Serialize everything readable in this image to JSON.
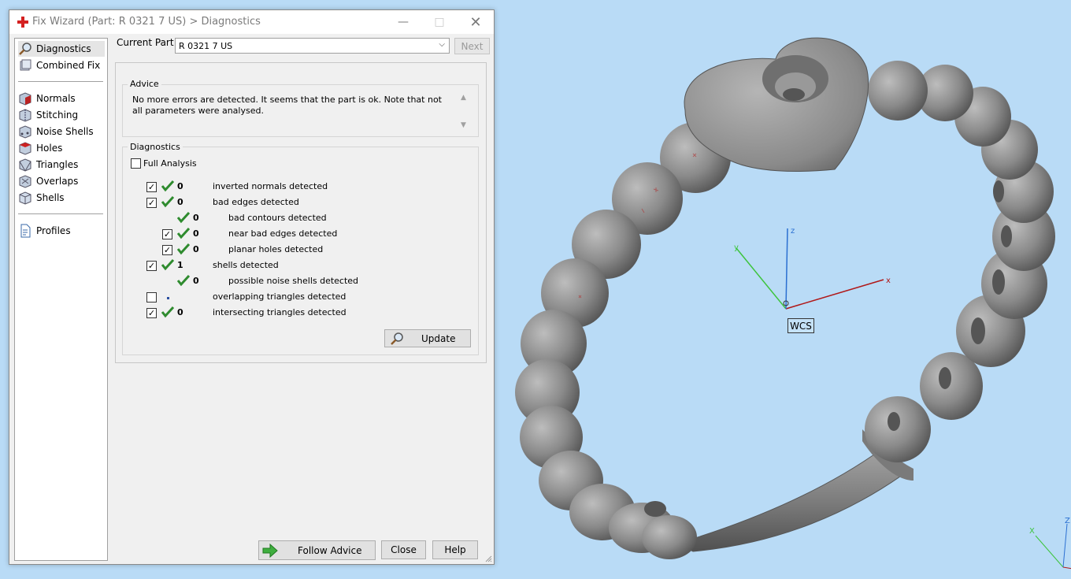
{
  "window": {
    "title": "Fix Wizard (Part: R 0321 7 US) > Diagnostics",
    "minimize_glyph": "—",
    "maximize_glyph": "□",
    "close_glyph": "✕"
  },
  "nav": {
    "items": [
      {
        "label": "Diagnostics",
        "icon": "magnifier-icon",
        "selected": true
      },
      {
        "label": "Combined Fix",
        "icon": "combined-fix-icon"
      },
      {
        "label": "Normals",
        "icon": "normals-cube-icon"
      },
      {
        "label": "Stitching",
        "icon": "stitching-cube-icon"
      },
      {
        "label": "Noise Shells",
        "icon": "noise-shells-cube-icon"
      },
      {
        "label": "Holes",
        "icon": "holes-cube-icon"
      },
      {
        "label": "Triangles",
        "icon": "triangles-cube-icon"
      },
      {
        "label": "Overlaps",
        "icon": "overlaps-cube-icon"
      },
      {
        "label": "Shells",
        "icon": "shells-cube-icon"
      },
      {
        "label": "Profiles",
        "icon": "document-icon"
      }
    ]
  },
  "current_part": {
    "label": "Current Part:",
    "value": "R 0321 7 US",
    "next_label": "Next"
  },
  "advice": {
    "title": "Advice",
    "text": "No more errors are detected. It seems that the part is ok. Note that not all parameters were analysed."
  },
  "diagnostics": {
    "title": "Diagnostics",
    "full_analysis_label": "Full Analysis",
    "full_analysis_checked": false,
    "rows": [
      {
        "checkbox": true,
        "checked": true,
        "status": "ok",
        "count": "0",
        "label": "inverted normals detected",
        "indent": 0
      },
      {
        "checkbox": true,
        "checked": true,
        "status": "ok",
        "count": "0",
        "label": "bad edges detected",
        "indent": 0
      },
      {
        "checkbox": false,
        "checked": false,
        "status": "ok",
        "count": "0",
        "label": "bad contours detected",
        "indent": 1
      },
      {
        "checkbox": true,
        "checked": true,
        "status": "ok",
        "count": "0",
        "label": "near bad edges detected",
        "indent": 1
      },
      {
        "checkbox": true,
        "checked": true,
        "status": "ok",
        "count": "0",
        "label": "planar holes detected",
        "indent": 1
      },
      {
        "checkbox": true,
        "checked": true,
        "status": "ok",
        "count": "1",
        "label": "shells detected",
        "indent": 0
      },
      {
        "checkbox": false,
        "checked": false,
        "status": "ok",
        "count": "0",
        "label": "possible noise shells detected",
        "indent": 1
      },
      {
        "checkbox": true,
        "checked": false,
        "status": "dot",
        "count": "",
        "label": "overlapping triangles detected",
        "indent": 0
      },
      {
        "checkbox": true,
        "checked": true,
        "status": "ok",
        "count": "0",
        "label": "intersecting triangles detected",
        "indent": 0
      }
    ],
    "update_label": "Update"
  },
  "footer": {
    "follow_advice_label": "Follow Advice",
    "close_label": "Close",
    "help_label": "Help"
  },
  "viewport": {
    "wcs_label": "WCS",
    "axis_x": "x",
    "axis_y": "y",
    "axis_z": "z",
    "corner_axis_x": "X",
    "corner_axis_z": "Z",
    "background": "#b9dbf6",
    "model_color": "#8c8c8c"
  },
  "colors": {
    "check_green": "#2e8b2e",
    "axis_x": "#b01818",
    "axis_y": "#3ec43e",
    "axis_z": "#2a6fd1",
    "title_logo": "#d42020"
  }
}
